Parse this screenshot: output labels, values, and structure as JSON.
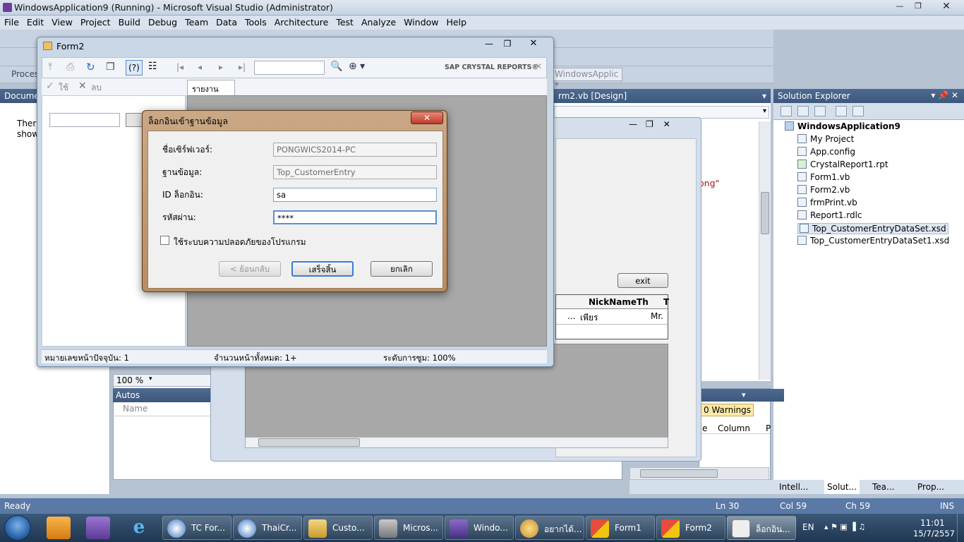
{
  "vs": {
    "title": "WindowsApplication9 (Running) - Microsoft Visual Studio (Administrator)",
    "menu": [
      "File",
      "Edit",
      "View",
      "Project",
      "Build",
      "Debug",
      "Team",
      "Data",
      "Tools",
      "Architecture",
      "Test",
      "Analyze",
      "Window",
      "Help"
    ],
    "process_label": "Proces",
    "docs_label": "Docume",
    "docs_text_1": "Ther",
    "docs_text_2": "show",
    "design_tab": "rm2.vb [Design]",
    "code_fragment": "ong\"",
    "zoom": "100 %",
    "win_fragment": "WindowsApplic",
    "exit_label": "exit",
    "grid_headers": [
      "NickNameTh",
      "T"
    ],
    "grid_cells": [
      "...",
      "เพียร",
      "Mr."
    ],
    "autos": {
      "title": "Autos",
      "col_name": "Name"
    },
    "errors": {
      "warnings": "0 Warnings",
      "col_e": "e",
      "col_column": "Column",
      "col_p": "P"
    }
  },
  "solution_explorer": {
    "title": "Solution Explorer",
    "root": "WindowsApplication9",
    "items": [
      "My Project",
      "App.config",
      "CrystalReport1.rpt",
      "Form1.vb",
      "Form2.vb",
      "frmPrint.vb",
      "Report1.rdlc",
      "Top_CustomerEntryDataSet.xsd",
      "Top_CustomerEntryDataSet1.xsd"
    ],
    "tabs": [
      "Intell...",
      "Solut...",
      "Tea...",
      "Prop..."
    ]
  },
  "status": {
    "ready": "Ready",
    "ln": "Ln 30",
    "col": "Col 59",
    "ch": "Ch 59",
    "ins": "INS"
  },
  "form2": {
    "title": "Form2",
    "brand": "SAP CRYSTAL REPORTS®",
    "ok_label": "ใช้",
    "delete_label": "ลบ",
    "main_tab": "รายงานหลัก",
    "status_page": "หมายเลขหน้าปัจจุบัน: 1",
    "status_total": "จำนวนหน้าทั้งหมด: 1+",
    "status_zoom": "ระดับการซูม: 100%"
  },
  "dialog": {
    "title": "ล็อกอินเข้าฐานข้อมูล",
    "server_label": "ชื่อเซิร์ฟเวอร์:",
    "server_value": "PONGWICS2014-PC",
    "db_label": "ฐานข้อมูล:",
    "db_value": "Top_CustomerEntry",
    "login_label": "ID ล็อกอิน:",
    "login_value": "sa",
    "pwd_label": "รหัสผ่าน:",
    "pwd_value": "****",
    "checkbox_label": "ใช้ระบบความปลอดภัยของโปรแกรม",
    "back_btn": "< ย้อนกลับ",
    "finish_btn": "เสร็จสิ้น",
    "cancel_btn": "ยกเลิก"
  },
  "taskbar": {
    "items": [
      "TC For...",
      "ThaiCr...",
      "Custo...",
      "Micros...",
      "Windo...",
      "อยากได้...",
      "Form1",
      "Form2",
      "ล็อกอิน..."
    ],
    "lang": "EN",
    "time": "11:01",
    "date": "15/7/2557"
  }
}
